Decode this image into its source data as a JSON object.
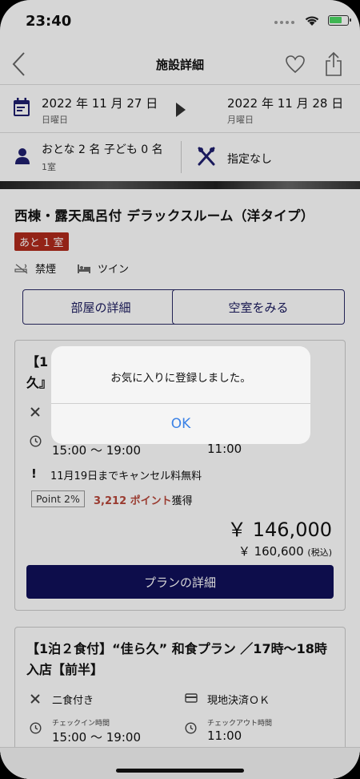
{
  "status_bar": {
    "time": "23:40"
  },
  "nav": {
    "title": "施設詳細"
  },
  "stay": {
    "checkin_date": "2022 年 11 月 27 日",
    "checkin_weekday": "日曜日",
    "checkout_date": "2022 年 11 月 28 日",
    "checkout_weekday": "月曜日"
  },
  "guests": {
    "summary": "おとな 2 名 子ども 0 名",
    "rooms": "1室",
    "meal_filter": "指定なし"
  },
  "room": {
    "title": "西棟・露天風呂付 デラックスルーム（洋タイプ）",
    "remaining": "あと 1 室",
    "smoking": "禁煙",
    "bed": "ツイン",
    "details_button": "部屋の詳細",
    "availability_button": "空室をみる"
  },
  "plan1": {
    "title_line1": "【1",
    "title_line2": "久』",
    "checkin_time": "15:00 〜 19:00",
    "checkout_time": "11:00",
    "cancel_note": "11月19日までキャンセル料無料",
    "point_rate": "Point 2%",
    "points": "3,212 ポイント",
    "points_suffix": "獲得",
    "price": "￥ 146,000",
    "price_original": "￥ 160,600",
    "tax_note": "(税込)",
    "detail_button": "プランの詳細"
  },
  "plan2": {
    "title": "【1泊２食付】“佳ら久” 和食プラン ／17時〜18時入店【前半】",
    "meal": "二食付き",
    "payment": "現地決済ＯＫ",
    "checkin_label": "チェックイン時間",
    "checkin_time": "15:00 〜 19:00",
    "checkout_label": "チェックアウト時間",
    "checkout_time": "11:00"
  },
  "alert": {
    "message": "お気に入りに登録しました。",
    "ok_label": "OK"
  }
}
